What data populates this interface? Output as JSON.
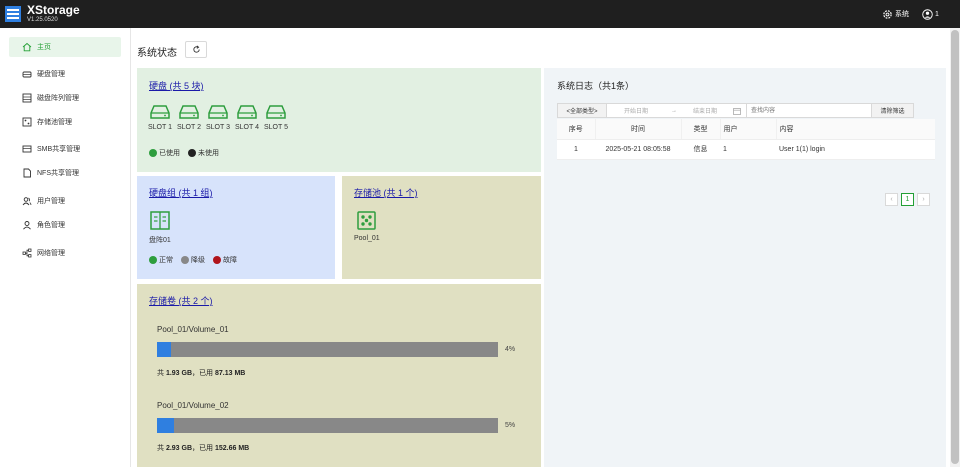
{
  "header": {
    "app_name": "XStorage",
    "version": "V1.25.0520",
    "system_label": "系统",
    "user_label": "1"
  },
  "sidebar": {
    "items": [
      {
        "label": "主页",
        "icon": "home-icon"
      },
      {
        "label": "硬盘管理",
        "icon": "disk-icon"
      },
      {
        "label": "磁盘阵列管理",
        "icon": "array-icon"
      },
      {
        "label": "存储池管理",
        "icon": "pool-icon"
      },
      {
        "label": "SMB共享管理",
        "icon": "smb-icon"
      },
      {
        "label": "NFS共享管理",
        "icon": "nfs-icon"
      },
      {
        "label": "用户管理",
        "icon": "users-icon"
      },
      {
        "label": "角色管理",
        "icon": "role-icon"
      },
      {
        "label": "网络管理",
        "icon": "network-icon"
      }
    ]
  },
  "page": {
    "title": "系统状态"
  },
  "disks": {
    "link": "硬盘 (共 5 块)",
    "slots": [
      "SLOT 1",
      "SLOT 2",
      "SLOT 3",
      "SLOT 4",
      "SLOT 5"
    ],
    "legend": {
      "used": "已使用",
      "unused": "未使用"
    }
  },
  "groups": {
    "link": "硬盘组 (共 1 组)",
    "items": [
      "盘阵01"
    ],
    "legend": {
      "normal": "正常",
      "degraded": "降级",
      "fault": "故障"
    }
  },
  "pools": {
    "link": "存储池 (共 1 个)",
    "items": [
      "Pool_01"
    ]
  },
  "volumes": {
    "link": "存储卷 (共 2 个)",
    "items": [
      {
        "name": "Pool_01/Volume_01",
        "percent": 4,
        "percent_label": "4%",
        "total_prefix": "共 ",
        "total": "1.93 GB",
        "used_prefix": "，已用 ",
        "used": "87.13 MB"
      },
      {
        "name": "Pool_01/Volume_02",
        "percent": 5,
        "percent_label": "5%",
        "total_prefix": "共 ",
        "total": "2.93 GB",
        "used_prefix": "，已用 ",
        "used": "152.66 MB"
      }
    ]
  },
  "logs": {
    "title": "系统日志（共1条）",
    "filter": {
      "type": "<全部类型>",
      "start_placeholder": "开始日期",
      "arrow": "→",
      "end_placeholder": "结束日期",
      "search_placeholder": "查找内容",
      "clear": "清除筛选"
    },
    "columns": [
      "序号",
      "时间",
      "类型",
      "用户",
      "内容"
    ],
    "rows": [
      [
        "1",
        "2025-05-21 08:05:58",
        "信息",
        "1",
        "User 1(1) login"
      ]
    ],
    "pagination": {
      "prev": "‹",
      "current": "1",
      "next": "›"
    }
  },
  "colors": {
    "used": "#2e9e3e",
    "unused": "#222222",
    "normal": "#2e9e3e",
    "degraded": "#888888",
    "fault": "#b0141c",
    "accent": "#23a035",
    "progress": "#2f7fe0"
  }
}
